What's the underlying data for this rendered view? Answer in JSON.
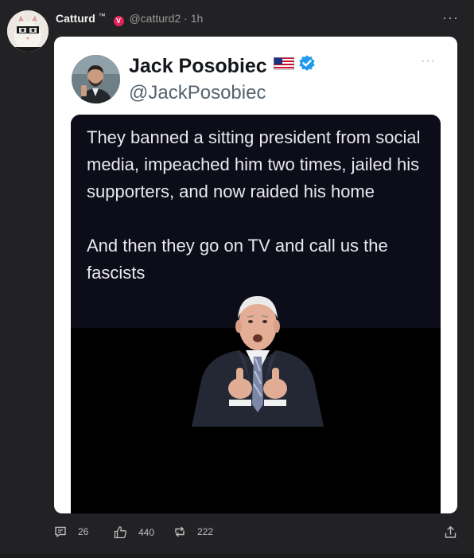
{
  "post": {
    "author_name": "Catturd",
    "author_tm": "™",
    "verified_badge": "V",
    "handle": "@catturd2",
    "separator": "·",
    "time": "1h",
    "more": "···"
  },
  "tweet": {
    "name": "Jack Posobiec",
    "handle": "@JackPosobiec",
    "more": "···",
    "quote_line1": "They banned a sitting president from social media, impeached him two times, jailed his supporters, and now raided his home",
    "quote_line2": "And then they go on TV and call us the fascists"
  },
  "actions": {
    "comments": "26",
    "likes": "440",
    "reposts": "222"
  },
  "icons": [
    "avatar",
    "verified-badge",
    "more-icon",
    "us-flag-icon",
    "verified-check-icon",
    "comment-icon",
    "like-icon",
    "repost-icon",
    "share-icon"
  ],
  "colors": {
    "background": "#222225",
    "card": "#ffffff",
    "verified_blue": "#1d9bf0",
    "badge_red": "#e0245e"
  }
}
